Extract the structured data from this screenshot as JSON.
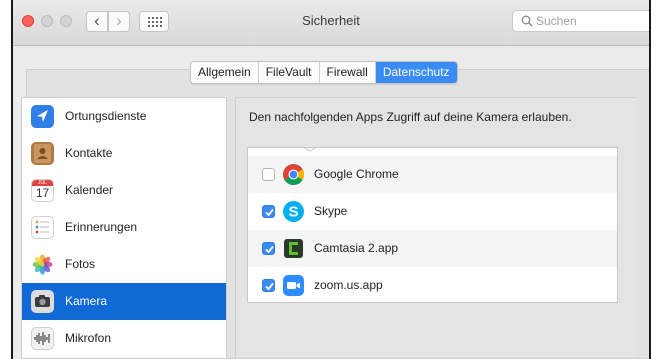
{
  "window": {
    "title": "Sicherheit"
  },
  "search": {
    "placeholder": "Suchen",
    "value": ""
  },
  "tabs": [
    {
      "label": "Allgemein",
      "active": false
    },
    {
      "label": "FileVault",
      "active": false
    },
    {
      "label": "Firewall",
      "active": false
    },
    {
      "label": "Datenschutz",
      "active": true
    }
  ],
  "sidebar": {
    "items": [
      {
        "label": "Ortungsdienste",
        "icon": "location-arrow-icon"
      },
      {
        "label": "Kontakte",
        "icon": "contacts-book-icon"
      },
      {
        "label": "Kalender",
        "icon": "calendar-icon",
        "icon_month": "JUL",
        "icon_day": "17"
      },
      {
        "label": "Erinnerungen",
        "icon": "reminders-icon"
      },
      {
        "label": "Fotos",
        "icon": "photos-flower-icon"
      },
      {
        "label": "Kamera",
        "icon": "camera-icon",
        "selected": true
      },
      {
        "label": "Mikrofon",
        "icon": "microphone-waveform-icon"
      }
    ]
  },
  "main": {
    "description": "Den nachfolgenden Apps Zugriff auf deine Kamera erlauben.",
    "apps": [
      {
        "name": "Google Chrome",
        "checked": false,
        "icon": "chrome-icon"
      },
      {
        "name": "Skype",
        "checked": true,
        "icon": "skype-icon"
      },
      {
        "name": "Camtasia 2.app",
        "checked": true,
        "icon": "camtasia-icon"
      },
      {
        "name": "zoom.us.app",
        "checked": true,
        "icon": "zoom-icon"
      }
    ]
  },
  "colors": {
    "accent": "#3a8cf4",
    "selection": "#1169d6",
    "close": "#fc5f57",
    "checkbox_on": "#3b8cf0"
  }
}
